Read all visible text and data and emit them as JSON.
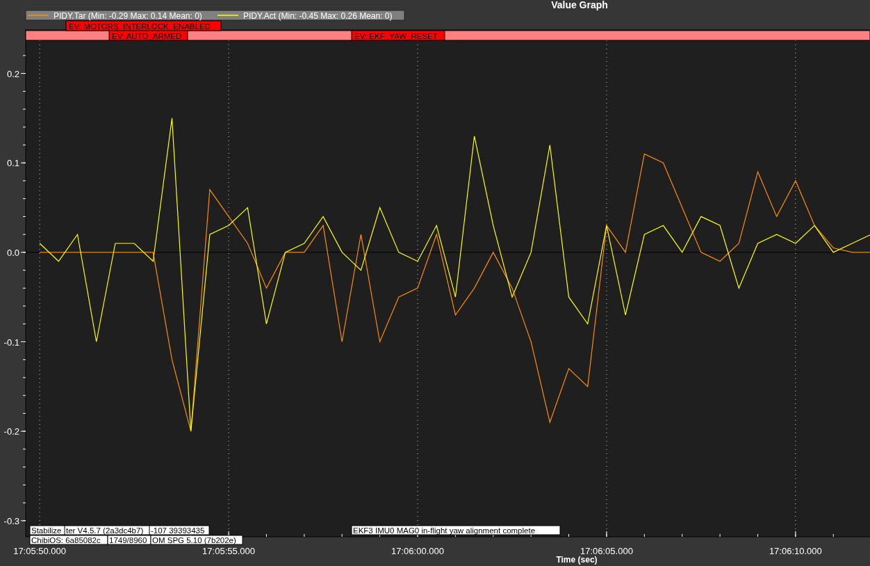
{
  "window": {
    "title": "Value Graph"
  },
  "chart": {
    "chart_data": {
      "type": "line",
      "xlabel": "Time (sec)",
      "categories": [
        "17:05:50.000",
        null,
        null,
        null,
        null,
        null,
        null,
        null,
        null,
        null,
        "17:05:55.000",
        null,
        null,
        null,
        null,
        null,
        null,
        null,
        null,
        null,
        "17:06:00.000",
        null,
        null,
        null,
        null,
        null,
        null,
        null,
        null,
        null,
        "17:06:05.000",
        null,
        null,
        null,
        null,
        null,
        null,
        null,
        null,
        null,
        "17:06:10.000",
        null,
        null,
        null,
        null
      ],
      "series": [
        {
          "name": "PIDY.Tar",
          "color": "#ff8c00",
          "values": [
            0,
            0,
            0,
            0,
            0,
            0,
            0,
            -0.12,
            -0.2,
            0.07,
            0.04,
            0.01,
            -0.04,
            0,
            0,
            0.03,
            -0.1,
            0.02,
            -0.1,
            -0.05,
            -0.04,
            0.02,
            -0.07,
            -0.04,
            0,
            -0.04,
            -0.1,
            -0.19,
            -0.13,
            -0.15,
            0.03,
            0,
            0.11,
            0.1,
            0.05,
            0,
            -0.01,
            0.01,
            0.09,
            0.04,
            0.08,
            0.03,
            0.005,
            0,
            0
          ]
        },
        {
          "name": "PIDY.Act",
          "color": "#ffff00",
          "values": [
            0.01,
            -0.01,
            0.02,
            -0.1,
            0.01,
            0.01,
            -0.01,
            0.15,
            -0.2,
            0.02,
            0.03,
            0.05,
            -0.08,
            0,
            0.01,
            0.04,
            0,
            -0.02,
            0.05,
            0,
            -0.01,
            0.03,
            -0.05,
            0.13,
            0.03,
            -0.05,
            0,
            0.12,
            -0.05,
            -0.08,
            0.03,
            -0.07,
            0.02,
            0.03,
            0,
            0.04,
            0.03,
            -0.04,
            0.01,
            0.02,
            0.01,
            0.03,
            0,
            0.01,
            0.02
          ]
        }
      ],
      "grid": true,
      "ylim": [
        -0.318,
        0.237
      ],
      "yticks": [
        {
          "value": 0.2,
          "label": "0.2"
        },
        {
          "value": 0.1,
          "label": "0.1"
        },
        {
          "value": 0,
          "label": "0.0"
        },
        {
          "value": -0.1,
          "label": "-0.1"
        },
        {
          "value": -0.2,
          "label": "-0.2"
        },
        {
          "value": -0.3,
          "label": "-0.3"
        }
      ]
    },
    "legend": [
      {
        "stats": "(Min: -0.29 Max: 0.14 Mean: 0)"
      },
      {
        "stats": "(Min: -0.45 Max: 0.26 Mean: 0)"
      }
    ],
    "events": [
      "EV: MOTORS_INTERLOCK_ENABLED",
      "EV: AUTO_ARMED",
      "EV: EKF_YAW_RESET"
    ],
    "messages": [
      "Stabilize",
      "ter V4.5.7 (2a3dc4b7)",
      "-107 39393435",
      "EKF3 IMU0 MAG0 in-flight yaw alignment complete",
      "ChibiOS: 6a85082c",
      "1749/8960",
      "OM SPG 5.10 (7b202e)"
    ]
  }
}
